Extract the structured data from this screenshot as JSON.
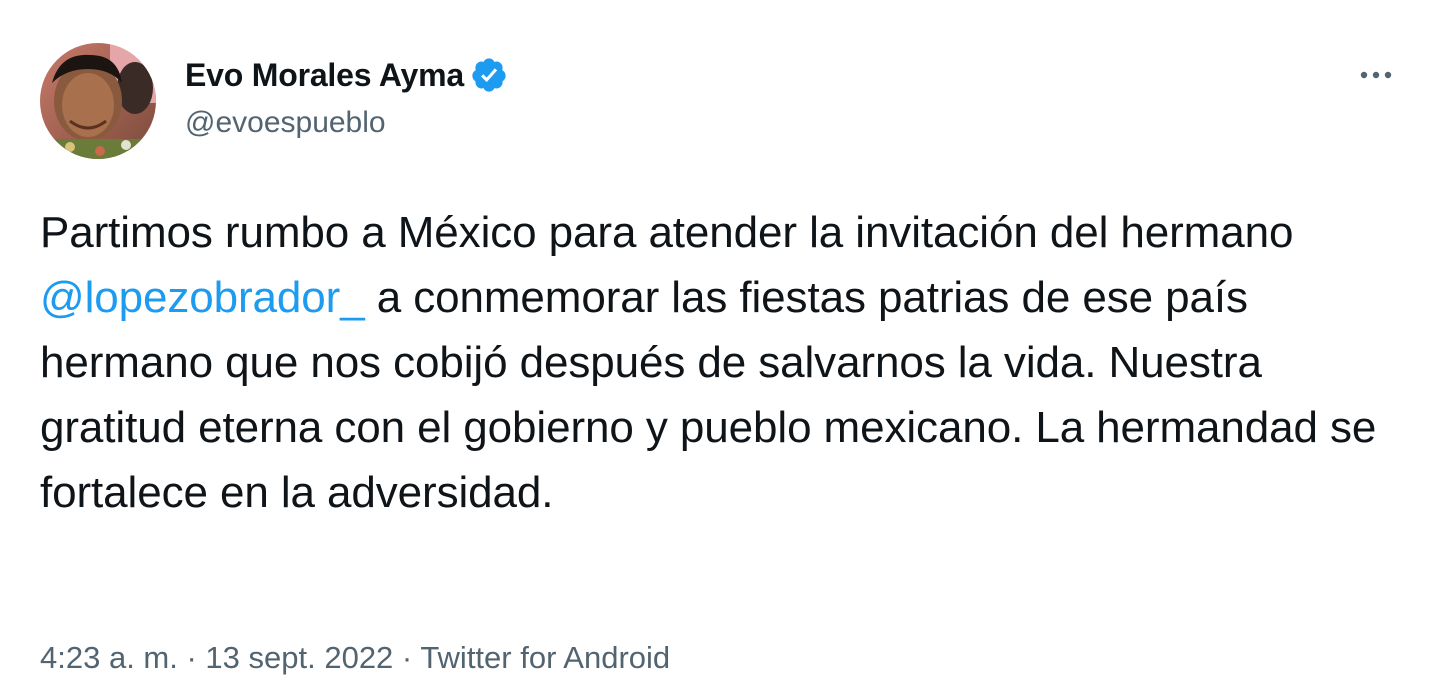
{
  "author": {
    "display_name": "Evo Morales Ayma",
    "handle": "@evoespueblo",
    "verified": true
  },
  "tweet": {
    "text_before": "Partimos rumbo a México para atender la invitación del hermano ",
    "mention": "@lopezobrador_",
    "text_after": " a conmemorar las fiestas patrias de ese país hermano que nos cobijó después de salvarnos la vida. Nuestra gratitud eterna con el gobierno y pueblo mexicano. La hermandad se fortalece en la adversidad."
  },
  "meta": {
    "time": "4:23 a. m.",
    "separator": " · ",
    "date": "13 sept. 2022",
    "source": "Twitter for Android"
  },
  "icons": {
    "verified": "verified-badge-icon",
    "more": "more-options-icon"
  },
  "colors": {
    "accent": "#1d9bf0",
    "text": "#0f1419",
    "secondary": "#536471"
  }
}
